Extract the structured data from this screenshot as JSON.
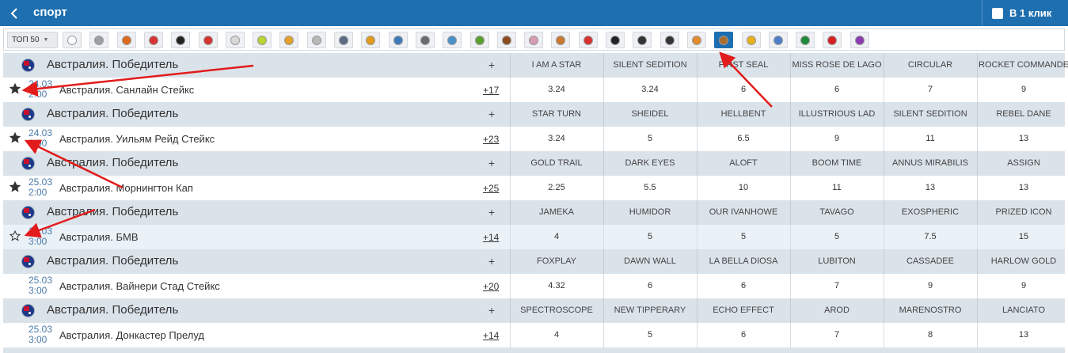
{
  "header": {
    "title": "спорт",
    "one_click_label": "В 1 клик"
  },
  "sport_filter": {
    "label": "ТОП 50"
  },
  "sport_icons": [
    {
      "name": "soccer-icon",
      "color": "#ffffff",
      "active": false
    },
    {
      "name": "hockey-icon",
      "color": "#9aa0a6",
      "active": false
    },
    {
      "name": "basketball-icon",
      "color": "#e06a1c",
      "active": false
    },
    {
      "name": "boxing-glove-icon",
      "color": "#d93434",
      "active": false
    },
    {
      "name": "tire-icon",
      "color": "#222222",
      "active": false
    },
    {
      "name": "volleyball-icon",
      "color": "#d6342e",
      "active": false
    },
    {
      "name": "golf-icon",
      "color": "#d8d8d8",
      "active": false
    },
    {
      "name": "tennis-icon",
      "color": "#b9d430",
      "active": false
    },
    {
      "name": "volleyball-ball-icon",
      "color": "#e3a12b",
      "active": false
    },
    {
      "name": "baseball-icon",
      "color": "#b8b8b8",
      "active": false
    },
    {
      "name": "gamepad-icon",
      "color": "#5b6b86",
      "active": false
    },
    {
      "name": "billiards-icon",
      "color": "#e39a1d",
      "active": false
    },
    {
      "name": "cap-icon",
      "color": "#3d7ab8",
      "active": false
    },
    {
      "name": "finish-flag-icon",
      "color": "#6a6a6a",
      "active": false
    },
    {
      "name": "shark-icon",
      "color": "#4a90c8",
      "active": false
    },
    {
      "name": "rugby-ball-icon",
      "color": "#5aa02c",
      "active": false
    },
    {
      "name": "american-football-icon",
      "color": "#8b4b1e",
      "active": false
    },
    {
      "name": "handball-icon",
      "color": "#d99bb0",
      "active": false
    },
    {
      "name": "horse-racing-icon",
      "color": "#c9792f",
      "active": false
    },
    {
      "name": "darts-icon",
      "color": "#d92f2f",
      "active": false
    },
    {
      "name": "yin-yang-icon",
      "color": "#222222",
      "active": false
    },
    {
      "name": "horse-icon",
      "color": "#333333",
      "active": false
    },
    {
      "name": "trotting-horse-icon",
      "color": "#333333",
      "active": false
    },
    {
      "name": "table-icon",
      "color": "#e38a2e",
      "active": false
    },
    {
      "name": "greyhound-racing-icon",
      "color": "#a86d2d",
      "active": true
    },
    {
      "name": "helmet-icon",
      "color": "#e8b21c",
      "active": false
    },
    {
      "name": "badminton-icon",
      "color": "#4d7fc9",
      "active": false
    },
    {
      "name": "eye-icon",
      "color": "#1c8a3a",
      "active": false
    },
    {
      "name": "table-tennis-icon",
      "color": "#d92020",
      "active": false
    },
    {
      "name": "ball-purple-icon",
      "color": "#8d3bb0",
      "active": false
    }
  ],
  "groups": [
    {
      "league": "Австралия. Победитель",
      "plus": "+",
      "runners": [
        "I AM A STAR",
        "SILENT SEDITION",
        "FIRST SEAL",
        "MISS ROSE DE LAGO",
        "CIRCULAR",
        "ROCKET COMMANDER"
      ],
      "date": "24.03",
      "time": "2:00",
      "event": "Австралия. Санлайн Стейкс",
      "more": "+17",
      "star": "filled",
      "odds": [
        "3.24",
        "3.24",
        "6",
        "6",
        "7",
        "9"
      ]
    },
    {
      "league": "Австралия. Победитель",
      "plus": "+",
      "runners": [
        "STAR TURN",
        "SHEIDEL",
        "HELLBENT",
        "ILLUSTRIOUS LAD",
        "SILENT SEDITION",
        "REBEL DANE"
      ],
      "date": "24.03",
      "time": "3:00",
      "event": "Австралия. Уильям Рейд Стейкс",
      "more": "+23",
      "star": "filled",
      "odds": [
        "3.24",
        "5",
        "6.5",
        "9",
        "11",
        "13"
      ]
    },
    {
      "league": "Австралия. Победитель",
      "plus": "+",
      "runners": [
        "GOLD TRAIL",
        "DARK EYES",
        "ALOFT",
        "BOOM TIME",
        "ANNUS MIRABILIS",
        "ASSIGN"
      ],
      "date": "25.03",
      "time": "2:00",
      "event": "Австралия. Морнингтон Кап",
      "more": "+25",
      "star": "filled",
      "odds": [
        "2.25",
        "5.5",
        "10",
        "11",
        "13",
        "13"
      ]
    },
    {
      "league": "Австралия. Победитель",
      "plus": "+",
      "runners": [
        "JAMEKA",
        "HUMIDOR",
        "OUR IVANHOWE",
        "TAVAGO",
        "EXOSPHERIC",
        "PRIZED ICON"
      ],
      "date": "25.03",
      "time": "3:00",
      "event": "Австралия. БМВ",
      "more": "+14",
      "star": "outline",
      "odds": [
        "4",
        "5",
        "5",
        "5",
        "7.5",
        "15"
      ]
    },
    {
      "league": "Австралия. Победитель",
      "plus": "+",
      "runners": [
        "FOXPLAY",
        "DAWN WALL",
        "LA BELLA DIOSA",
        "LUBITON",
        "CASSADEE",
        "HARLOW GOLD"
      ],
      "date": "25.03",
      "time": "3:00",
      "event": "Австралия. Вайнери Стад Стейкс",
      "more": "+20",
      "star": "none",
      "odds": [
        "4.32",
        "6",
        "6",
        "7",
        "9",
        "9"
      ]
    },
    {
      "league": "Австралия. Победитель",
      "plus": "+",
      "runners": [
        "SPECTROSCOPE",
        "NEW TIPPERARY",
        "ECHO EFFECT",
        "AROD",
        "MARENOSTRO",
        "LANCIATO"
      ],
      "date": "25.03",
      "time": "3:00",
      "event": "Австралия. Донкастер Прелуд",
      "more": "+14",
      "star": "none",
      "odds": [
        "4",
        "5",
        "6",
        "7",
        "8",
        "13"
      ]
    }
  ]
}
